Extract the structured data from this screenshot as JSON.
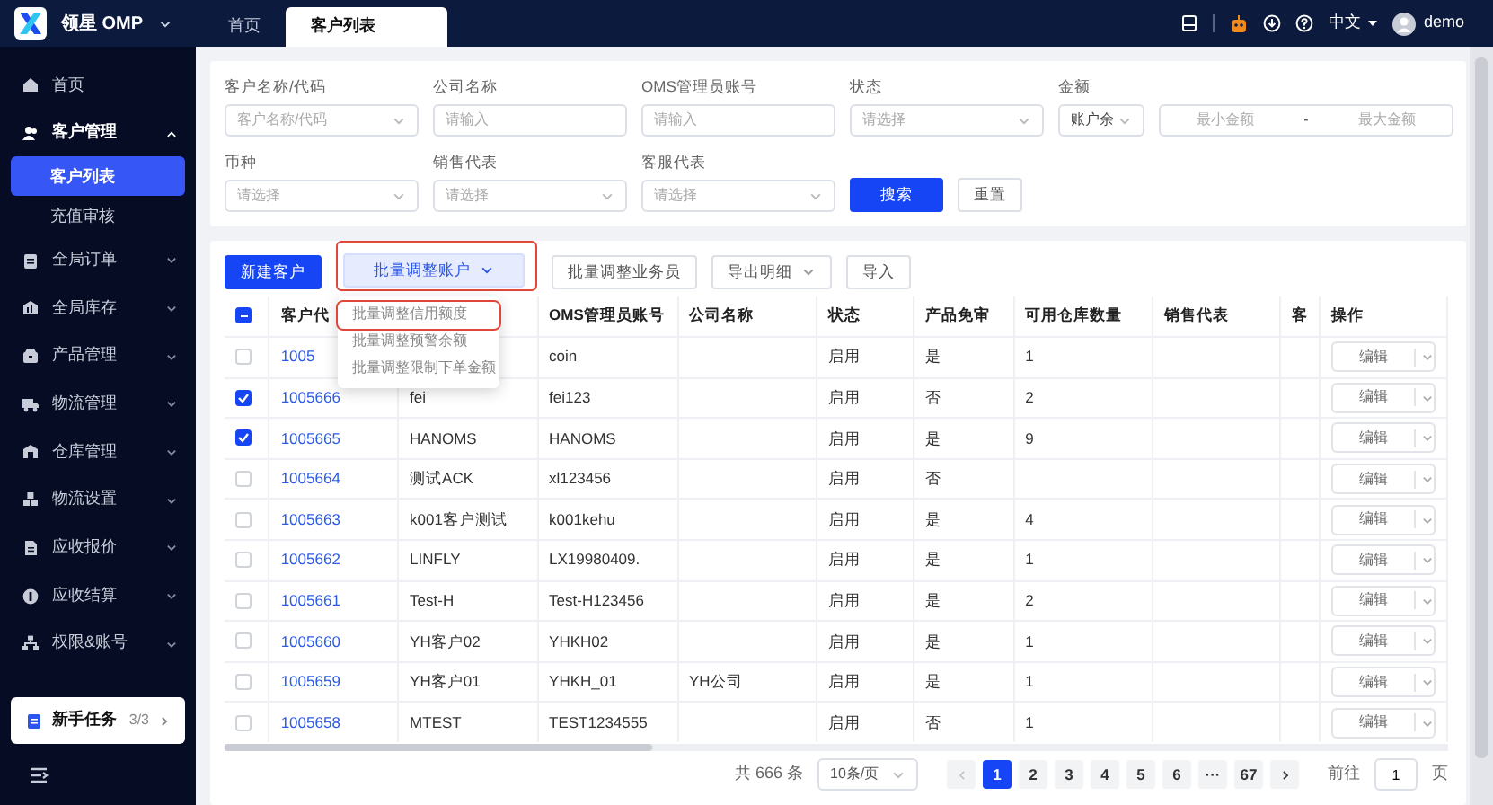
{
  "topbar": {
    "brand": "领星 OMP",
    "tabs": [
      {
        "label": "首页",
        "selected": false
      },
      {
        "label": "客户列表",
        "selected": true
      }
    ],
    "language": "中文",
    "user": "demo"
  },
  "sidebar": {
    "items": [
      {
        "label": "首页",
        "kind": "link"
      },
      {
        "label": "客户管理",
        "kind": "group",
        "expanded": true,
        "children": [
          {
            "label": "客户列表",
            "selected": true
          },
          {
            "label": "充值审核",
            "selected": false
          }
        ]
      },
      {
        "label": "全局订单",
        "kind": "group",
        "expanded": false
      },
      {
        "label": "全局库存",
        "kind": "group",
        "expanded": false
      },
      {
        "label": "产品管理",
        "kind": "group",
        "expanded": false
      },
      {
        "label": "物流管理",
        "kind": "group",
        "expanded": false
      },
      {
        "label": "仓库管理",
        "kind": "group",
        "expanded": false
      },
      {
        "label": "物流设置",
        "kind": "group",
        "expanded": false
      },
      {
        "label": "应收报价",
        "kind": "group",
        "expanded": false
      },
      {
        "label": "应收结算",
        "kind": "group",
        "expanded": false
      },
      {
        "label": "权限&账号",
        "kind": "group",
        "expanded": false
      }
    ],
    "task": {
      "label": "新手任务",
      "progress": "3/3"
    }
  },
  "filters": [
    {
      "kind": "select",
      "label": "客户名称/代码",
      "placeholder": "客户名称/代码"
    },
    {
      "kind": "input",
      "label": "公司名称",
      "placeholder": "请输入"
    },
    {
      "kind": "input",
      "label": "OMS管理员账号",
      "placeholder": "请输入"
    },
    {
      "kind": "select",
      "label": "状态",
      "placeholder": "请选择"
    },
    {
      "kind": "amount",
      "label": "金额",
      "value": "账户余",
      "min_placeholder": "最小金额",
      "separator": "-",
      "max_placeholder": "最大金额"
    },
    {
      "kind": "select",
      "label": "币种",
      "placeholder": "请选择"
    },
    {
      "kind": "select",
      "label": "销售代表",
      "placeholder": "请选择"
    },
    {
      "kind": "select",
      "label": "客服代表",
      "placeholder": "请选择"
    }
  ],
  "filter_buttons": [
    {
      "kind": "primary",
      "label": "搜索"
    },
    {
      "kind": "default",
      "label": "重置"
    }
  ],
  "toolbar": [
    {
      "kind": "primary",
      "label": "新建客户",
      "caret": false,
      "highlighted": false,
      "expanded": false
    },
    {
      "kind": "light",
      "label": "批量调整账户",
      "caret": true,
      "highlighted": true,
      "expanded": true
    },
    {
      "kind": "default",
      "label": "批量调整业务员",
      "caret": false,
      "highlighted": false,
      "expanded": false
    },
    {
      "kind": "default",
      "label": "导出明细",
      "caret": true,
      "highlighted": false,
      "expanded": false
    },
    {
      "kind": "default",
      "label": "导入",
      "caret": false,
      "highlighted": false,
      "expanded": false
    }
  ],
  "dropdown": [
    {
      "label": "批量调整信用额度",
      "highlighted": true
    },
    {
      "label": "批量调整预警余额",
      "highlighted": false
    },
    {
      "label": "批量调整限制下单金额",
      "highlighted": false
    }
  ],
  "table": {
    "header_checkbox": {
      "indeterminate": true
    },
    "columns": [
      {
        "label": "客户代"
      },
      {},
      {
        "label": "OMS管理员账号"
      },
      {
        "label": "公司名称"
      },
      {
        "label": "状态"
      },
      {
        "label": "产品免审"
      },
      {
        "label": "可用仓库数量"
      },
      {
        "label": "销售代表"
      },
      {
        "label": "客"
      },
      {
        "label": "操作"
      }
    ],
    "rows": [
      {
        "checked": false,
        "code": "1005",
        "oms": "coin",
        "status": "启用",
        "audit": "是",
        "qty": "1",
        "action": "编辑"
      },
      {
        "checked": true,
        "code": "1005666",
        "name": "fei",
        "oms": "fei123",
        "status": "启用",
        "audit": "否",
        "qty": "2",
        "action": "编辑"
      },
      {
        "checked": true,
        "code": "1005665",
        "name": "HANOMS",
        "oms": "HANOMS",
        "status": "启用",
        "audit": "是",
        "qty": "9",
        "action": "编辑"
      },
      {
        "checked": false,
        "code": "1005664",
        "name": "测试ACK",
        "oms": "xl123456",
        "status": "启用",
        "audit": "否",
        "action": "编辑"
      },
      {
        "checked": false,
        "code": "1005663",
        "name": "k001客户测试",
        "oms": "k001kehu",
        "status": "启用",
        "audit": "是",
        "qty": "4",
        "action": "编辑"
      },
      {
        "checked": false,
        "code": "1005662",
        "name": "LINFLY",
        "oms": "LX19980409.",
        "status": "启用",
        "audit": "是",
        "qty": "1",
        "action": "编辑"
      },
      {
        "checked": false,
        "code": "1005661",
        "name": "Test-H",
        "oms": "Test-H123456",
        "status": "启用",
        "audit": "是",
        "qty": "2",
        "action": "编辑"
      },
      {
        "checked": false,
        "code": "1005660",
        "name": "YH客户02",
        "oms": "YHKH02",
        "status": "启用",
        "audit": "是",
        "qty": "1",
        "action": "编辑"
      },
      {
        "checked": false,
        "code": "1005659",
        "name": "YH客户01",
        "oms": "YHKH_01",
        "company": "YH公司",
        "status": "启用",
        "audit": "是",
        "qty": "1",
        "action": "编辑"
      },
      {
        "checked": false,
        "code": "1005658",
        "name": "MTEST",
        "oms": "TEST1234555",
        "status": "启用",
        "audit": "否",
        "qty": "1",
        "action": "编辑"
      }
    ]
  },
  "pagination": {
    "total": "共 666 条",
    "page_size": "10条/页",
    "prev_disabled": true,
    "pages": [
      {
        "label": "1",
        "selected": true
      },
      {
        "label": "2",
        "selected": false
      },
      {
        "label": "3",
        "selected": false
      },
      {
        "label": "4",
        "selected": false
      },
      {
        "label": "5",
        "selected": false
      },
      {
        "label": "6",
        "selected": false
      },
      {
        "label": "···",
        "selected": false
      },
      {
        "label": "67",
        "selected": false
      }
    ],
    "goto_label": "前往",
    "goto_value": "1",
    "goto_unit": "页"
  }
}
